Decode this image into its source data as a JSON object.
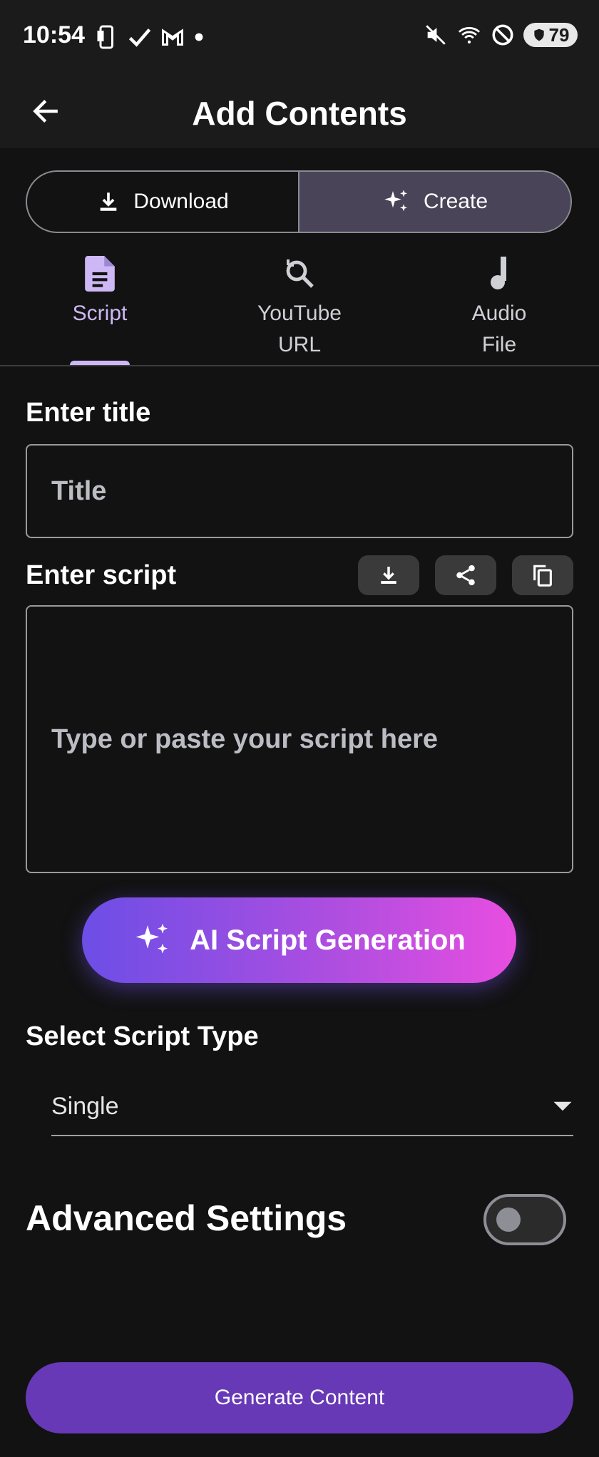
{
  "status_bar": {
    "time": "10:54",
    "battery": "79"
  },
  "app_bar": {
    "title": "Add Contents"
  },
  "segmented": {
    "download_label": "Download",
    "create_label": "Create",
    "active": "create"
  },
  "tabs": [
    {
      "label": "Script",
      "icon": "document-icon"
    },
    {
      "label": "YouTube\nURL",
      "icon": "search-refresh-icon"
    },
    {
      "label": "Audio\nFile",
      "icon": "music-note-icon"
    }
  ],
  "form": {
    "title_label": "Enter title",
    "title_placeholder": "Title",
    "script_label": "Enter script",
    "script_placeholder": "Type or paste your script here",
    "ai_button_label": "AI Script Generation",
    "type_label": "Select Script Type",
    "type_selected": "Single",
    "advanced_label": "Advanced Settings",
    "advanced_enabled": false,
    "generate_label": "Generate Content"
  },
  "colors": {
    "accent": "#cdb8f5",
    "primary_button": "#6739b6",
    "gradient_start": "#6c4ee6",
    "gradient_end": "#e84ee0",
    "background": "#121212"
  }
}
